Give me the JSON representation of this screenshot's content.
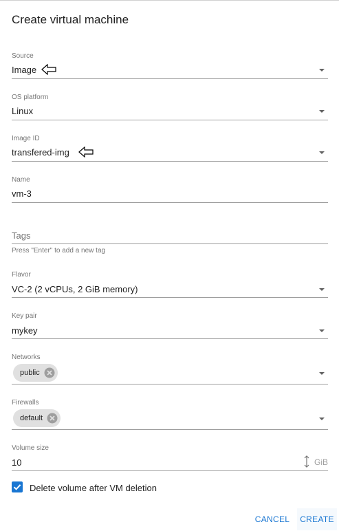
{
  "dialog": {
    "title": "Create virtual machine",
    "accent_color": "#1976d2"
  },
  "fields": {
    "source": {
      "label": "Source",
      "value": "Image"
    },
    "os_platform": {
      "label": "OS platform",
      "value": "Linux"
    },
    "image_id": {
      "label": "Image ID",
      "value": "transfered-img"
    },
    "name": {
      "label": "Name",
      "value": "vm-3"
    },
    "tags": {
      "placeholder": "Tags",
      "hint": "Press \"Enter\" to add a new tag"
    },
    "flavor": {
      "label": "Flavor",
      "value": "VC-2 (2 vCPUs, 2 GiB memory)"
    },
    "key_pair": {
      "label": "Key pair",
      "value": "mykey"
    },
    "networks": {
      "label": "Networks",
      "chips": [
        "public"
      ]
    },
    "firewalls": {
      "label": "Firewalls",
      "chips": [
        "default"
      ]
    },
    "volume_size": {
      "label": "Volume size",
      "value": "10",
      "unit": "GiB"
    }
  },
  "delete_volume": {
    "label": "Delete volume after VM deletion",
    "checked": true
  },
  "actions": {
    "cancel": "CANCEL",
    "create": "CREATE"
  }
}
